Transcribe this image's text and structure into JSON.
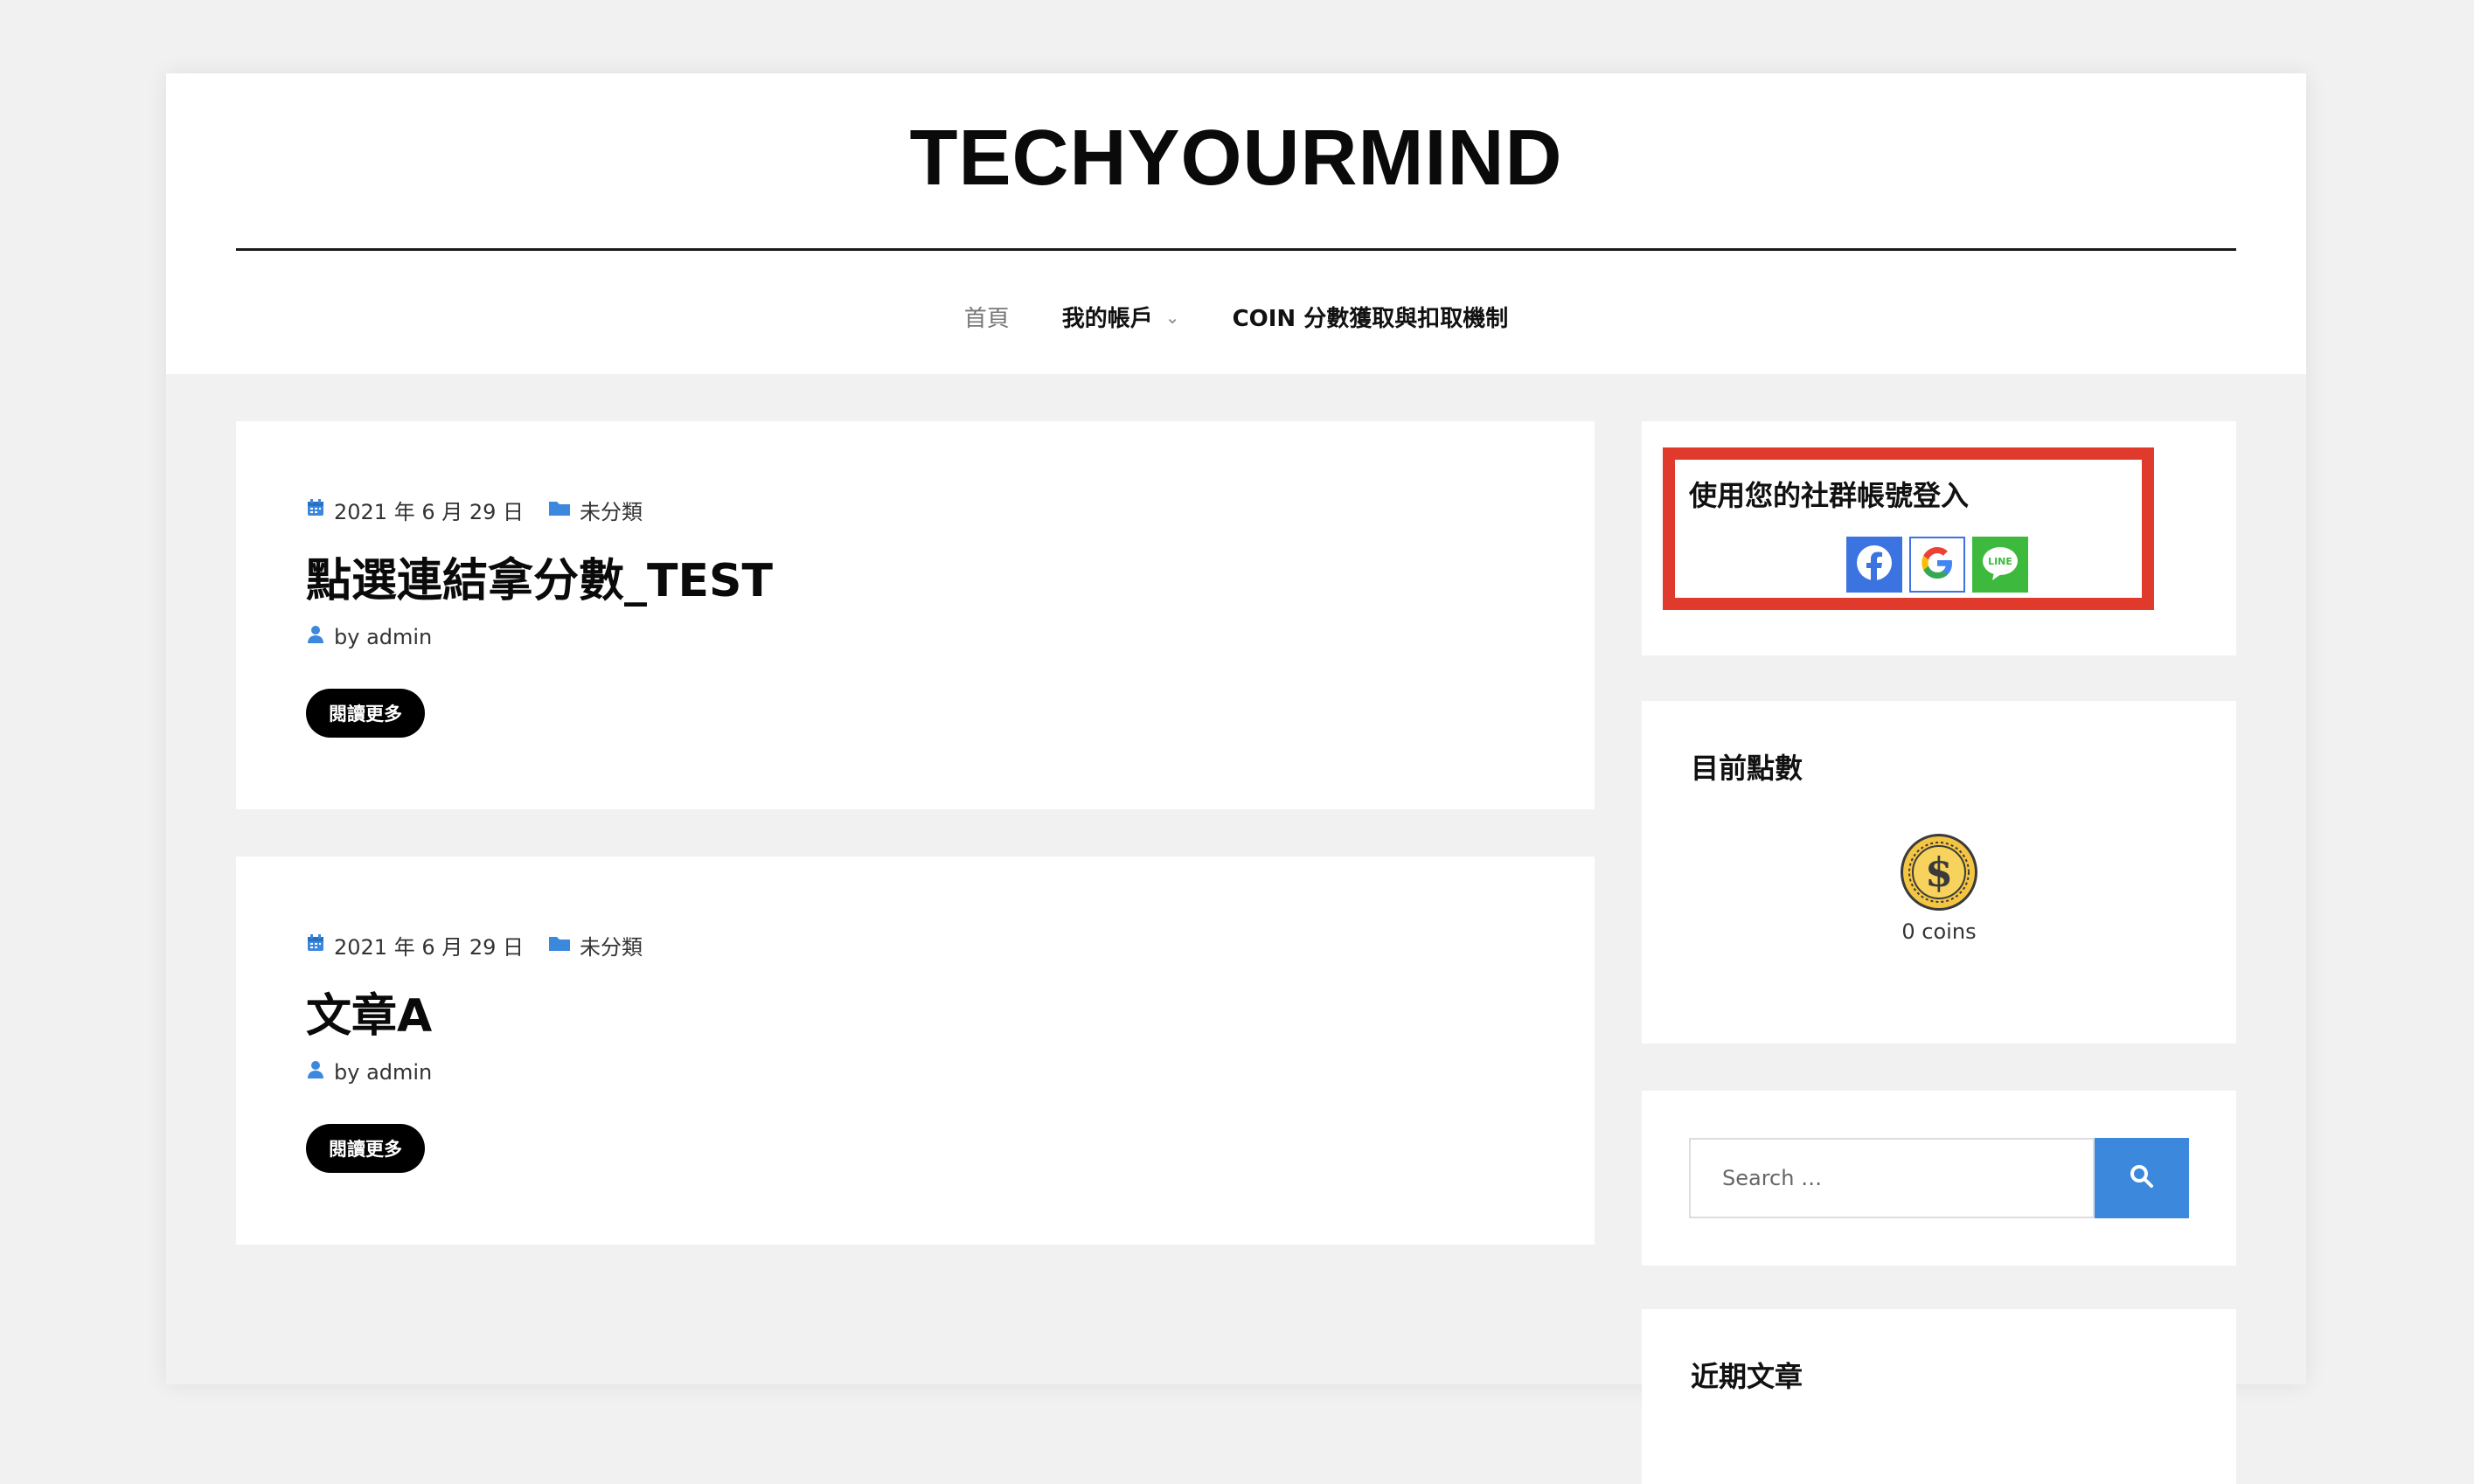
{
  "site": {
    "title": "TECHYOURMIND"
  },
  "nav": {
    "items": [
      {
        "label": "首頁"
      },
      {
        "label": "我的帳戶"
      },
      {
        "label": "COIN 分數獲取與扣取機制"
      }
    ]
  },
  "posts": [
    {
      "date": "2021 年 6 月 29 日",
      "category": "未分類",
      "title": "點選連結拿分數_TEST",
      "author": "by admin",
      "more_label": "閱讀更多"
    },
    {
      "date": "2021 年 6 月 29 日",
      "category": "未分類",
      "title": "文章A",
      "author": "by admin",
      "more_label": "閱讀更多"
    }
  ],
  "sidebar": {
    "login": {
      "title": "使用您的社群帳號登入",
      "providers": [
        "facebook-icon",
        "google-icon",
        "line-icon"
      ],
      "highlight_color": "#e03a2c"
    },
    "points": {
      "title": "目前點數",
      "coins_text": "0 coins"
    },
    "search": {
      "placeholder": "Search …"
    },
    "recent": {
      "title": "近期文章"
    }
  },
  "colors": {
    "accent": "#3b88dd",
    "facebook": "#3b73e0",
    "line": "#3dba3d"
  }
}
